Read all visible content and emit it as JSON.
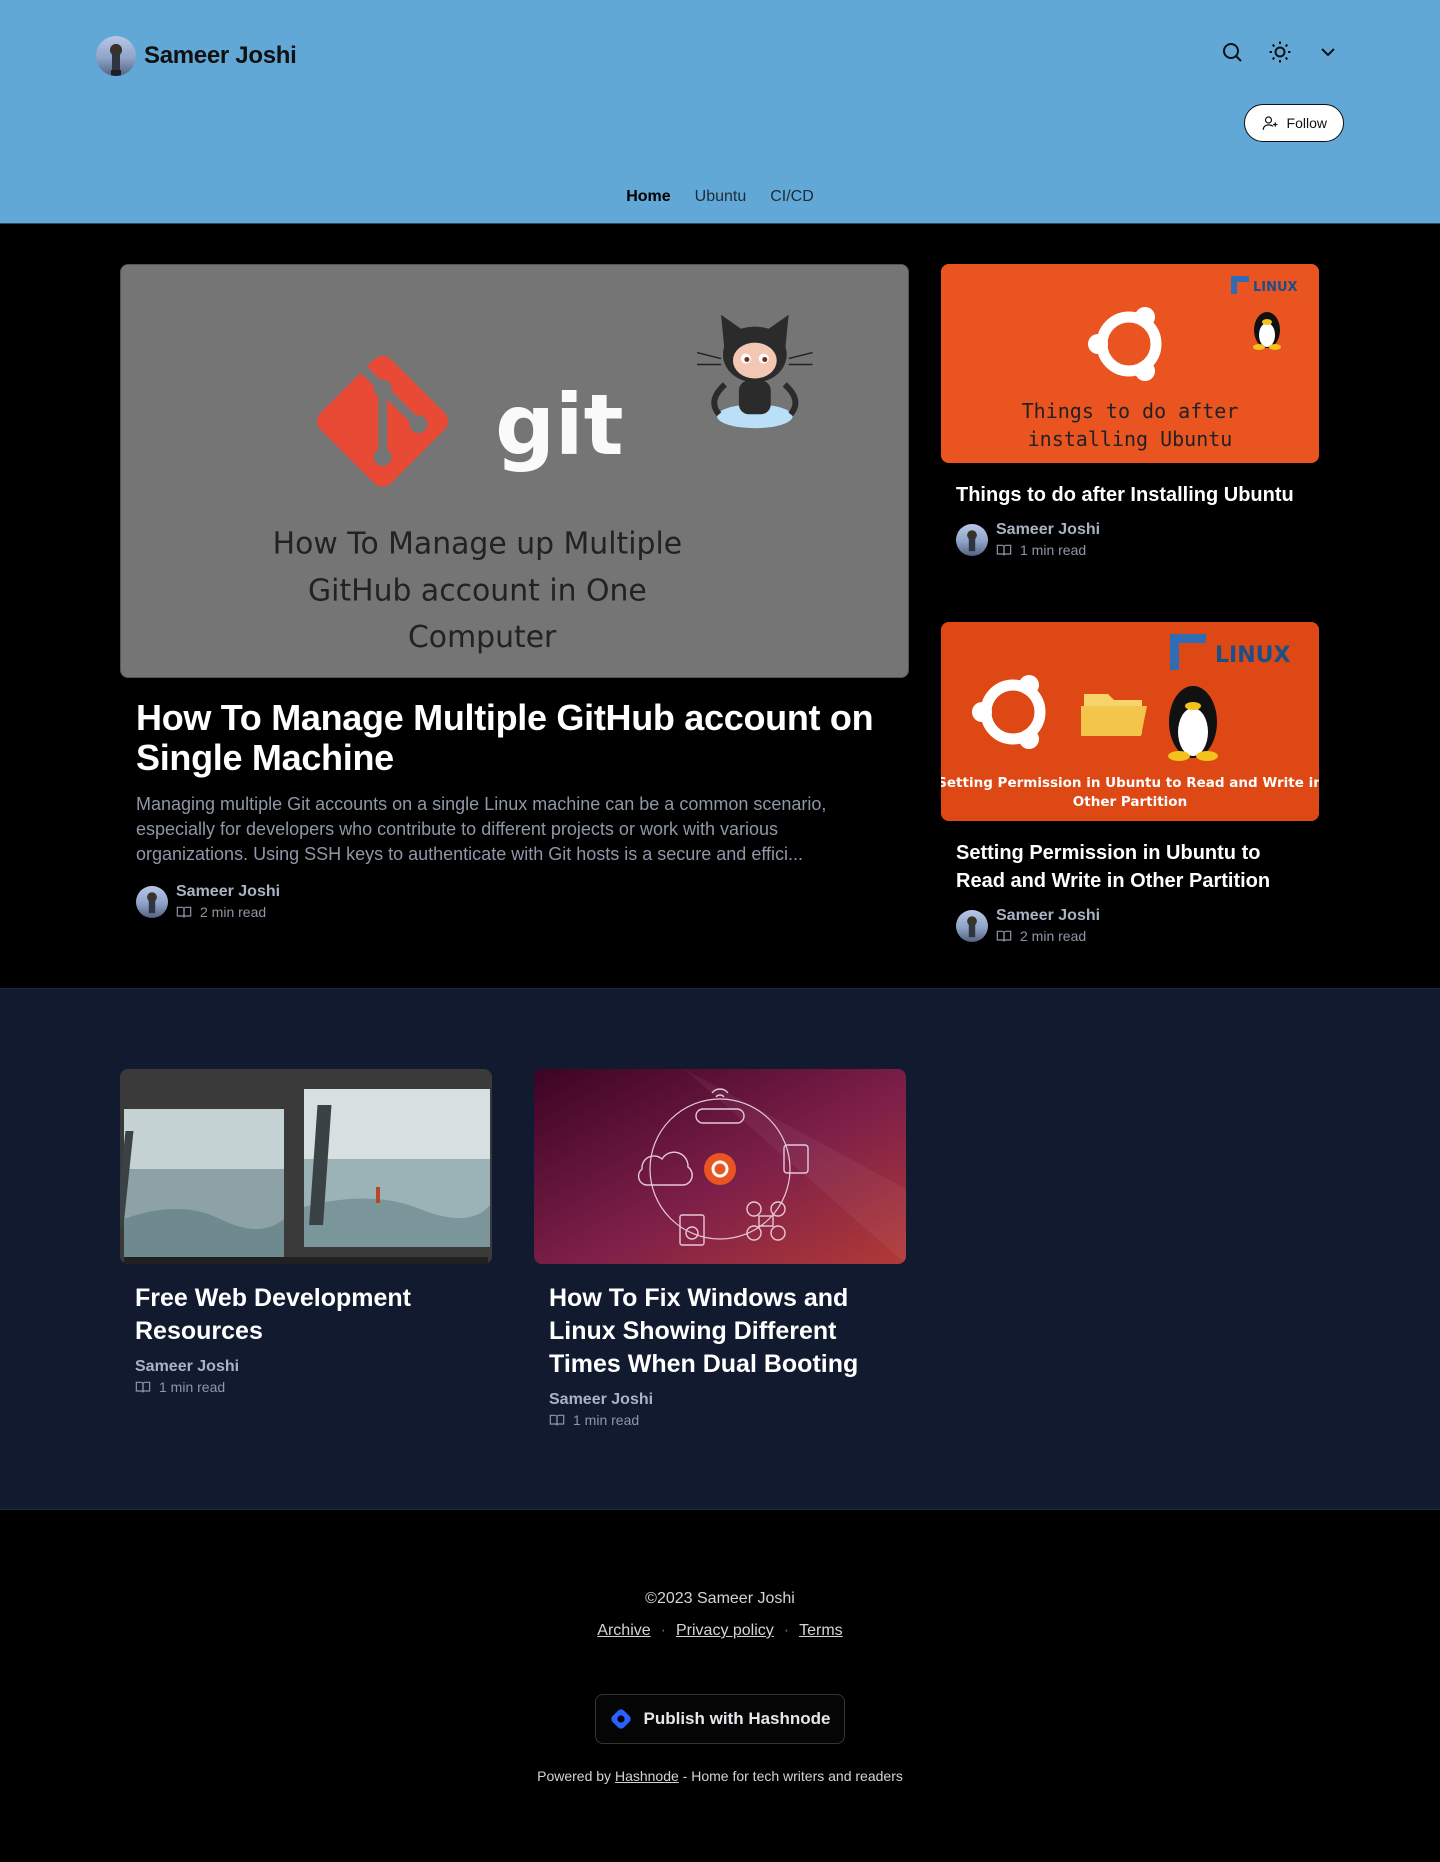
{
  "header": {
    "brand_name": "Sameer Joshi",
    "icons": [
      "search-icon",
      "sun-icon",
      "chevron-down-icon"
    ],
    "follow_label": "Follow",
    "background": "#61a8d6"
  },
  "nav": {
    "items": [
      {
        "label": "Home",
        "active": true
      },
      {
        "label": "Ubuntu",
        "active": false
      },
      {
        "label": "CI/CD",
        "active": false
      }
    ]
  },
  "featured": {
    "main": {
      "image_heading": "How To Manage up Multiple GitHub account in One Computer",
      "image_logo_text": "git",
      "title": "How To Manage Multiple GitHub account on Single Machine",
      "description": "Managing multiple Git accounts on a single Linux machine can be a common scenario, especially for developers who contribute to different projects or work with various organizations. Using SSH keys to authenticate with Git hosts is a secure and effici...",
      "author": "Sameer Joshi",
      "read_time": "2 min read"
    },
    "side": [
      {
        "image_caption": "Things to do after installing Ubuntu",
        "image_badge": "LINUX",
        "title": "Things to do after Installing Ubuntu",
        "author": "Sameer Joshi",
        "read_time": "1 min read"
      },
      {
        "image_caption": "Setting Permission in Ubuntu to Read and Write in Other Partition",
        "image_badge": "LINUX",
        "title": "Setting Permission in Ubuntu to Read and Write in Other Partition",
        "author": "Sameer Joshi",
        "read_time": "2 min read"
      }
    ]
  },
  "posts": [
    {
      "title": "Free Web Development Resources",
      "author": "Sameer Joshi",
      "read_time": "1 min read"
    },
    {
      "title": "How To Fix Windows and Linux Showing Different Times When Dual Booting",
      "author": "Sameer Joshi",
      "read_time": "1 min read"
    }
  ],
  "footer": {
    "copyright": "©2023 Sameer Joshi",
    "links": [
      "Archive",
      "Privacy policy",
      "Terms"
    ],
    "separator": "·",
    "publish_label": "Publish with Hashnode",
    "powered_prefix": "Powered by",
    "powered_link": "Hashnode",
    "powered_suffix": "- Home for tech writers and readers"
  }
}
